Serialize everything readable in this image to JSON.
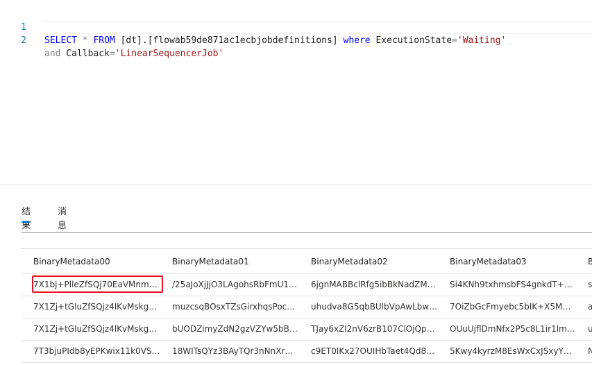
{
  "editor": {
    "lines": [
      {
        "num": "1",
        "tokens": [
          {
            "t": "SELECT",
            "k": "kw"
          },
          {
            "t": " ",
            "k": ""
          },
          {
            "t": "*",
            "k": "op"
          },
          {
            "t": " ",
            "k": ""
          },
          {
            "t": "FROM",
            "k": "kw"
          },
          {
            "t": " [dt].[flowab59de871ac1ecbjobdefinitions] ",
            "k": ""
          },
          {
            "t": "where",
            "k": "kw"
          },
          {
            "t": " ExecutionState",
            "k": ""
          },
          {
            "t": "=",
            "k": "op"
          },
          {
            "t": "'Waiting'",
            "k": "str"
          }
        ]
      },
      {
        "num": "2",
        "tokens": [
          {
            "t": "and",
            "k": "kw2"
          },
          {
            "t": " Callback",
            "k": ""
          },
          {
            "t": "=",
            "k": "op"
          },
          {
            "t": "'LinearSequencerJob'",
            "k": "str"
          }
        ]
      }
    ]
  },
  "tabs": {
    "results": "结果",
    "messages": "消息"
  },
  "grid": {
    "headers": [
      "BinaryMetadata00",
      "BinaryMetadata01",
      "BinaryMetadata02",
      "BinaryMetadata03",
      "B"
    ],
    "rows": [
      [
        "7X1bj+PlleZfSQj70EaVMnmVx...",
        "/25aJoXjJjO3LAgohsRbFmU1Gl...",
        "6jgnMABBclRfg5ibBkNadZM0r...",
        "Si4KNh9txhmsbFS4gnkdT+3Hh...",
        "s"
      ],
      [
        "7X1Zj+tGluZfSQjz4lKvMskgKYl...",
        "muzcsqBOsxTZsGirxhqsPocNH...",
        "uhudva8G5qbBUlbVpAwLbwHY...",
        "7OiZbGcFmyebc5bIK+X5MH3...",
        "a"
      ],
      [
        "7X1Zj+tGluZfSQjz4lKvMskgKYl...",
        "bUODZimyZdN2gzVZYw5bBqD...",
        "TJay6xZl2nV6zrB107ClOjQp1rA...",
        "OUuUjflDmNfx2P5c8L1ir1lmxz...",
        "u"
      ],
      [
        "7T3bjuPIdb8yEPKwix11k0VSEts...",
        "18WITsQYz3BAyTQr3nNnXrGs...",
        "c9ET0IKx27OUIHbTaet4Qd8zD...",
        "5Kwy4kyrzM8EsWxCxJSxyYnQw...",
        "N"
      ]
    ]
  }
}
